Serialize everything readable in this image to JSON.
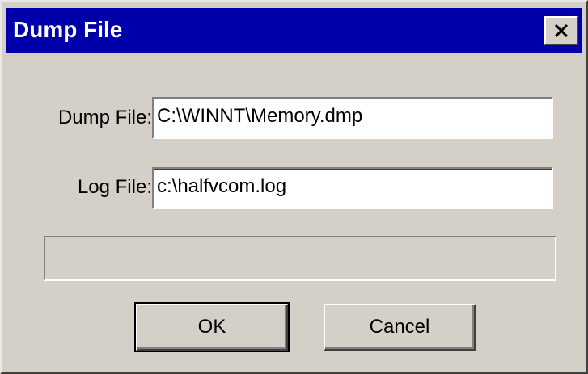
{
  "window": {
    "title": "Dump File"
  },
  "form": {
    "dump_file_label": "Dump File:",
    "dump_file_value": "C:\\WINNT\\Memory.dmp",
    "log_file_label": "Log File:",
    "log_file_value": "c:\\halfvcom.log"
  },
  "progress": {
    "fraction": 0
  },
  "buttons": {
    "ok_label": "OK",
    "cancel_label": "Cancel"
  },
  "icons": {
    "close": "close-icon"
  },
  "colors": {
    "titlebar": "#0000aa",
    "window_bg": "#d4d0c8"
  }
}
